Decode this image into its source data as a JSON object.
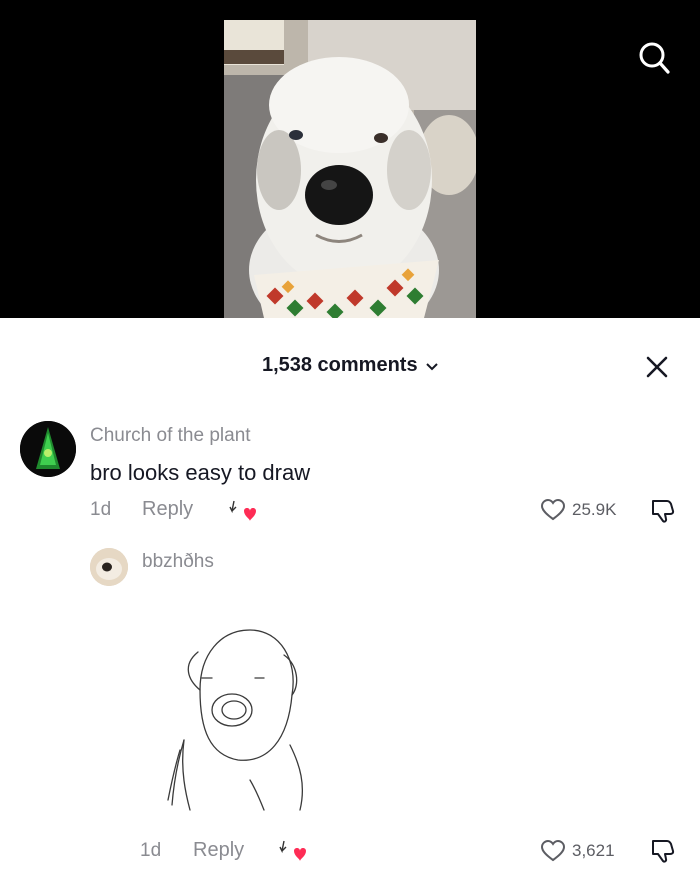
{
  "header": {
    "comments_count": "1,538 comments"
  },
  "comments": [
    {
      "username": "Church of the plant",
      "text": "bro looks easy to draw",
      "age": "1d",
      "reply_label": "Reply",
      "likes": "25.9K"
    },
    {
      "username": "bbzhðhs",
      "age": "1d",
      "reply_label": "Reply",
      "likes": "3,621"
    }
  ],
  "icons": {
    "search": "search-icon",
    "close": "close-icon",
    "heart": "heart-icon",
    "dislike": "thumbs-down-icon",
    "creator_like": "creator-liked-icon"
  },
  "colors": {
    "video_bg": "#000000",
    "heart_pink": "#fe2c55",
    "muted_text": "#8a8b91"
  }
}
